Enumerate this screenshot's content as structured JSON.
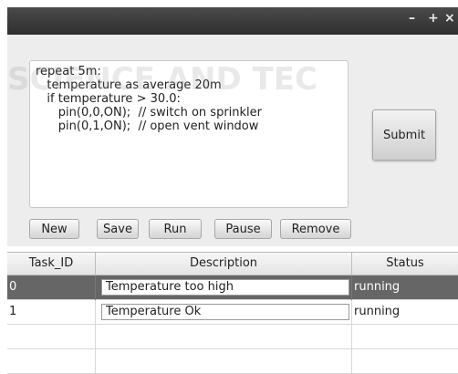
{
  "window": {
    "controls": {
      "minimize": "–",
      "maximize": "+",
      "close": "×"
    }
  },
  "watermark": {
    "line1": "SCIENCE AND TEC"
  },
  "editor": {
    "lines": [
      "repeat 5m:",
      "   temperature as average 20m",
      "   if temperature > 30.0:",
      "      pin(0,0,ON);  // switch on sprinkler",
      "      pin(0,1,ON);  // open vent window"
    ]
  },
  "buttons": {
    "submit": "Submit",
    "new": "New",
    "save": "Save",
    "run": "Run",
    "pause": "Pause",
    "remove": "Remove"
  },
  "table": {
    "headers": [
      "Task_ID",
      "Description",
      "Status"
    ],
    "rows": [
      {
        "id": "0",
        "description": "Temperature too high",
        "status": "running",
        "selected": true
      },
      {
        "id": "1",
        "description": "Temperature Ok",
        "status": "running",
        "selected": false
      },
      {
        "id": "",
        "description": "",
        "status": "",
        "selected": false
      },
      {
        "id": "",
        "description": "",
        "status": "",
        "selected": false
      }
    ]
  }
}
